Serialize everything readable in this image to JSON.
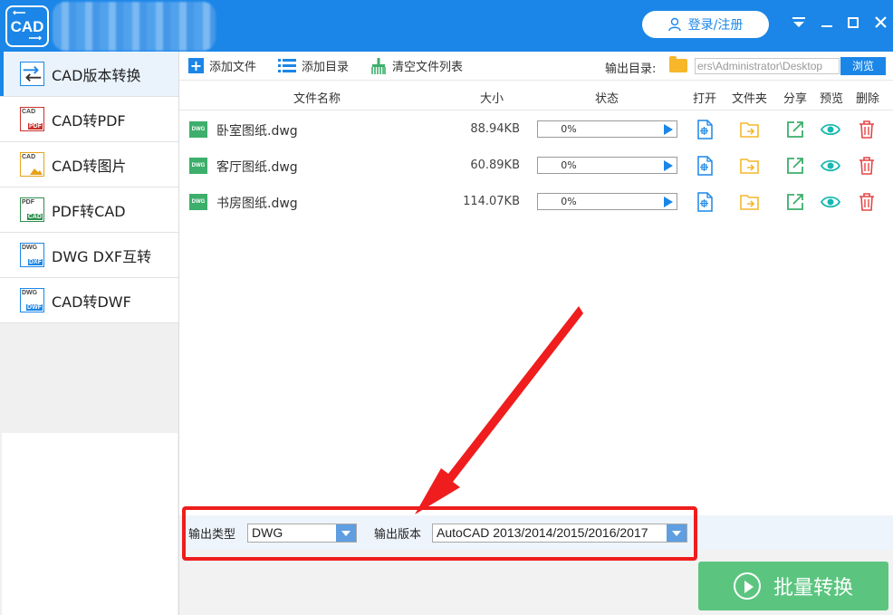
{
  "app": {
    "logo_text": "CAD",
    "login_label": "登录/注册",
    "window_controls": [
      "menu-icon",
      "minimize-icon",
      "maximize-icon",
      "close-icon"
    ]
  },
  "sidebar": {
    "items": [
      {
        "label": "CAD版本转换",
        "icon": "cad-version-icon",
        "active": true
      },
      {
        "label": "CAD转PDF",
        "icon": "cad-to-pdf-icon",
        "icon_top": "CAD",
        "icon_bottom": "PDF",
        "color": "#c9302c"
      },
      {
        "label": "CAD转图片",
        "icon": "cad-to-image-icon",
        "icon_top": "CAD",
        "icon_bottom": "",
        "color": "#e8a21a"
      },
      {
        "label": "PDF转CAD",
        "icon": "pdf-to-cad-icon",
        "icon_top": "PDF",
        "icon_bottom": "CAD",
        "color": "#2f8f4e"
      },
      {
        "label": "DWG DXF互转",
        "icon": "dwg-dxf-icon",
        "icon_top": "DWG",
        "icon_bottom": "DXF",
        "color": "#1b86e7"
      },
      {
        "label": "CAD转DWF",
        "icon": "cad-to-dwf-icon",
        "icon_top": "DWG",
        "icon_bottom": "DWF",
        "color": "#1b86e7"
      }
    ]
  },
  "toolbar": {
    "add_file": "添加文件",
    "add_dir": "添加目录",
    "clear_list": "清空文件列表",
    "output_dir_label": "输出目录:",
    "output_path": "ers\\Administrator\\Desktop",
    "browse": "浏览"
  },
  "table": {
    "headers": {
      "name": "文件名称",
      "size": "大小",
      "status": "状态",
      "open": "打开",
      "folder": "文件夹",
      "share": "分享",
      "preview": "预览",
      "delete": "删除"
    },
    "rows": [
      {
        "file_badge": "DWG",
        "name": "卧室图纸.dwg",
        "size": "88.94KB",
        "progress": "0%"
      },
      {
        "file_badge": "DWG",
        "name": "客厅图纸.dwg",
        "size": "60.89KB",
        "progress": "0%"
      },
      {
        "file_badge": "DWG",
        "name": "书房图纸.dwg",
        "size": "114.07KB",
        "progress": "0%"
      }
    ]
  },
  "output": {
    "type_label": "输出类型",
    "type_value": "DWG",
    "version_label": "输出版本",
    "version_value": "AutoCAD 2013/2014/2015/2016/2017"
  },
  "convert_button": "批量转换",
  "colors": {
    "brand_blue": "#1b86e7",
    "green": "#5bc57f",
    "folder_yellow": "#f6b72b",
    "delete_red": "#e64545",
    "preview_teal": "#18b8b0",
    "annotation_red": "#ef1d1d"
  }
}
